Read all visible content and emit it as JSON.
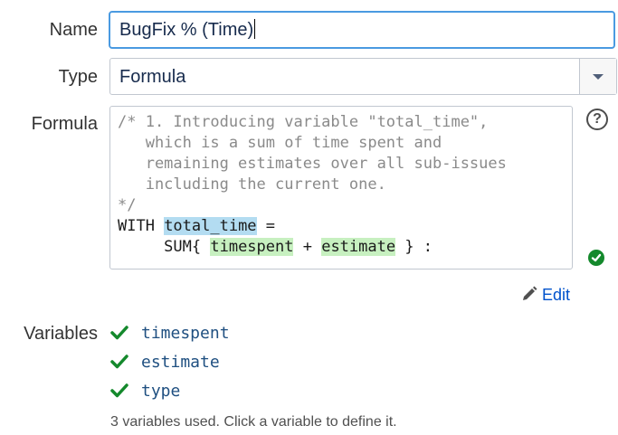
{
  "labels": {
    "name": "Name",
    "type": "Type",
    "formula": "Formula",
    "variables": "Variables"
  },
  "name_field": {
    "value": "BugFix % (Time)"
  },
  "type_select": {
    "value": "Formula"
  },
  "formula": {
    "lines": [
      "/* 1. Introducing variable \"total_time\",",
      "   which is a sum of time spent and",
      "   remaining estimates over all sub-issues",
      "   including the current one.",
      "*/"
    ],
    "with_keyword": "WITH ",
    "var_name": "total_time",
    "assign": " =",
    "sum_prefix": "     SUM{ ",
    "term1": "timespent",
    "plus": " + ",
    "term2": "estimate",
    "sum_suffix": " } :"
  },
  "help_icon": "?",
  "edit_link": "Edit",
  "variables": [
    "timespent",
    "estimate",
    "type"
  ],
  "variables_note": "3 variables used. Click a variable to define it.",
  "colors": {
    "accent": "#0052cc",
    "ok_green": "#14892c",
    "var_highlight": "#b3dcf1",
    "term_highlight": "#c7f0c0"
  }
}
